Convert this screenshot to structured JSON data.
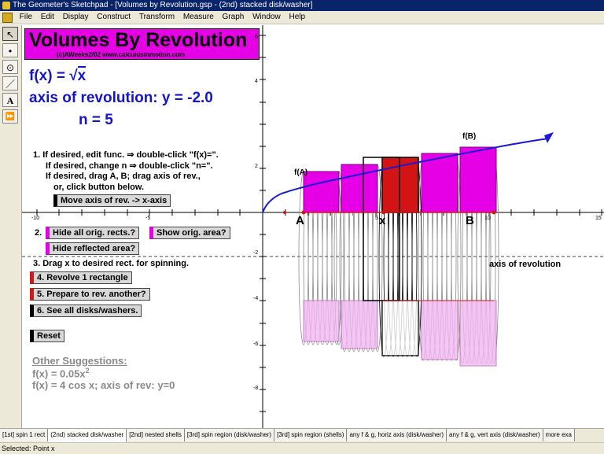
{
  "window": {
    "title": "The Geometer's Sketchpad - [Volumes by Revolution.gsp - (2nd) stacked disk/washer]"
  },
  "menu": [
    "File",
    "Edit",
    "Display",
    "Construct",
    "Transform",
    "Measure",
    "Graph",
    "Window",
    "Help"
  ],
  "toolbox": [
    {
      "icon": "arrow-select-icon",
      "glyph": "↖"
    },
    {
      "icon": "point-tool-icon",
      "glyph": "•"
    },
    {
      "icon": "compass-tool-icon",
      "glyph": "⊙"
    },
    {
      "icon": "straightedge-tool-icon",
      "glyph": "／"
    },
    {
      "icon": "text-tool-icon",
      "glyph": "A"
    },
    {
      "icon": "custom-tool-icon",
      "glyph": "⏩"
    }
  ],
  "sketch": {
    "title": "Volumes By Revolution",
    "subtitle": "(c)AWeeks2/02 www.calculusinmotion.com",
    "func_prefix": "f(x) = ",
    "func_radical": "√",
    "func_arg": "x",
    "axis_text": "axis of revolution: y = -2.0",
    "n_text": "n = 5",
    "instructions": [
      "1.  If desired, edit func. ⇒ double-click \"f(x)=\".",
      "If desired, change n ⇒ double-click \"n=\".",
      "If desired, drag A, B; drag axis of rev.,",
      "or, click button below."
    ],
    "step2_label": "2.",
    "step3_text": "3.  Drag x to desired rect. for spinning.",
    "buttons": {
      "move_axis": "Move axis of rev. -> x-axis",
      "hide_orig_rects": "Hide all orig. rects.?",
      "show_orig_area": "Show orig. area?",
      "hide_reflected": "Hide reflected area?",
      "revolve": "4. Revolve 1 rectangle",
      "prepare": "5.  Prepare to rev. another?",
      "see_all": "6.  See all disks/washers.",
      "reset": "Reset"
    },
    "suggestions": {
      "heading": "Other Suggestions:",
      "line1_prefix": "f(x) = 0.05x",
      "line1_exp": "2",
      "line2": "f(x) = 4 cos x; axis of rev: y=0"
    },
    "point_labels": {
      "fA": "f(A)",
      "fB": "f(B)",
      "A": "A",
      "x": "x",
      "B": "B"
    },
    "axis_of_revolution_label": "axis of revolution",
    "x_ticks": [
      "-10",
      "-5",
      "5",
      "10",
      "15"
    ],
    "y_ticks": [
      "6",
      "4",
      "2",
      "-2",
      "-4",
      "-6",
      "-8"
    ],
    "colors": {
      "magenta": "#e600e6",
      "red": "#d41414",
      "curve_blue": "#1a1ad6",
      "title_bg": "#e600e6"
    }
  },
  "tabs": [
    "[1st]  spin 1 rect",
    "(2nd) stacked disk/washer",
    "[2nd]  nested shells",
    "[3rd] spin region (disk/washer)",
    "[3rd] spin region (shells)",
    "any f & g, horiz axis (disk/washer)",
    "any f & g, vert axis (disk/washer)",
    "more exa"
  ],
  "status": "Selected: Point x"
}
